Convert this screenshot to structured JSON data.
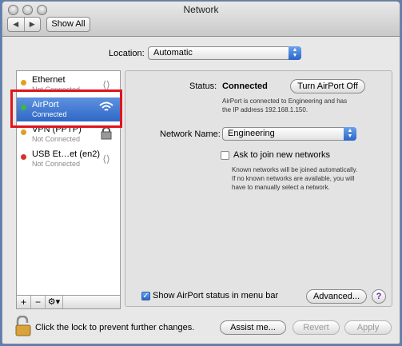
{
  "window": {
    "title": "Network"
  },
  "toolbar": {
    "back": "◀",
    "forward": "▶",
    "show_all": "Show All"
  },
  "location": {
    "label": "Location:",
    "value": "Automatic"
  },
  "services": [
    {
      "name": "Ethernet",
      "status": "Not Connected",
      "dot": "#e0a020",
      "icon": "ethernet-icon",
      "selected": false
    },
    {
      "name": "AirPort",
      "status": "Connected",
      "dot": "#3cba3c",
      "icon": "wifi-icon",
      "selected": true
    },
    {
      "name": "VPN (PPTP)",
      "status": "Not Connected",
      "dot": "#e0a020",
      "icon": "vpn-lock-icon",
      "selected": false
    },
    {
      "name": "USB Et…et (en2)",
      "status": "Not Connected",
      "dot": "#d83030",
      "icon": "ethernet-icon",
      "selected": false
    }
  ],
  "sidebar_tools": {
    "add": "+",
    "remove": "−",
    "gear": "⚙▾"
  },
  "detail": {
    "status_label": "Status:",
    "status_value": "Connected",
    "turn_off_button": "Turn AirPort Off",
    "status_desc_1": "AirPort is connected to Engineering and has",
    "status_desc_2": "the IP address 192.168.1.150.",
    "network_name_label": "Network Name:",
    "network_name_value": "Engineering",
    "ask_join_label": "Ask to join new networks",
    "ask_join_checked": false,
    "ask_desc_1": "Known networks will be joined automatically.",
    "ask_desc_2": "If no known networks are available, you will",
    "ask_desc_3": "have to manually select a network.",
    "show_status_label": "Show AirPort status in menu bar",
    "show_status_checked": true,
    "advanced_button": "Advanced...",
    "help_button": "?"
  },
  "footer": {
    "lock_text": "Click the lock to prevent further changes.",
    "assist_button": "Assist me...",
    "revert_button": "Revert",
    "apply_button": "Apply"
  },
  "colors": {
    "accent": "#2f68c6",
    "highlight_box": "#e0141d"
  }
}
